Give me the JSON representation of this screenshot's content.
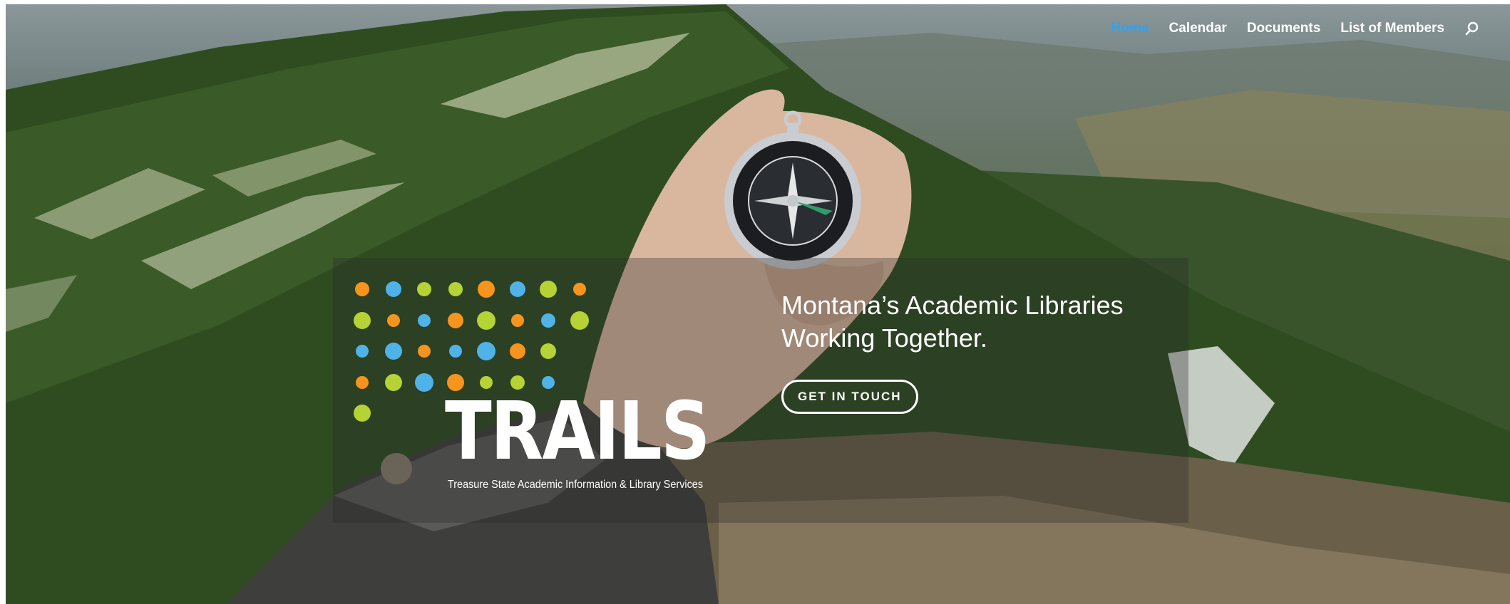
{
  "nav": {
    "items": [
      {
        "label": "Home",
        "active": true
      },
      {
        "label": "Calendar",
        "active": false
      },
      {
        "label": "Documents",
        "active": false
      },
      {
        "label": "List of Members",
        "active": false
      }
    ],
    "search_icon": "search-icon",
    "active_color": "#2ea3f2"
  },
  "logo": {
    "word": "TRAILS",
    "subtitle": "Treasure State Academic Information & Library Services",
    "dot_colors": [
      "#f7941d",
      "#4fb3e8",
      "#b5d334"
    ]
  },
  "hero": {
    "headline_line1": "Montana’s Academic Libraries",
    "headline_line2": "Working Together.",
    "cta_label": "GET IN TOUCH"
  }
}
